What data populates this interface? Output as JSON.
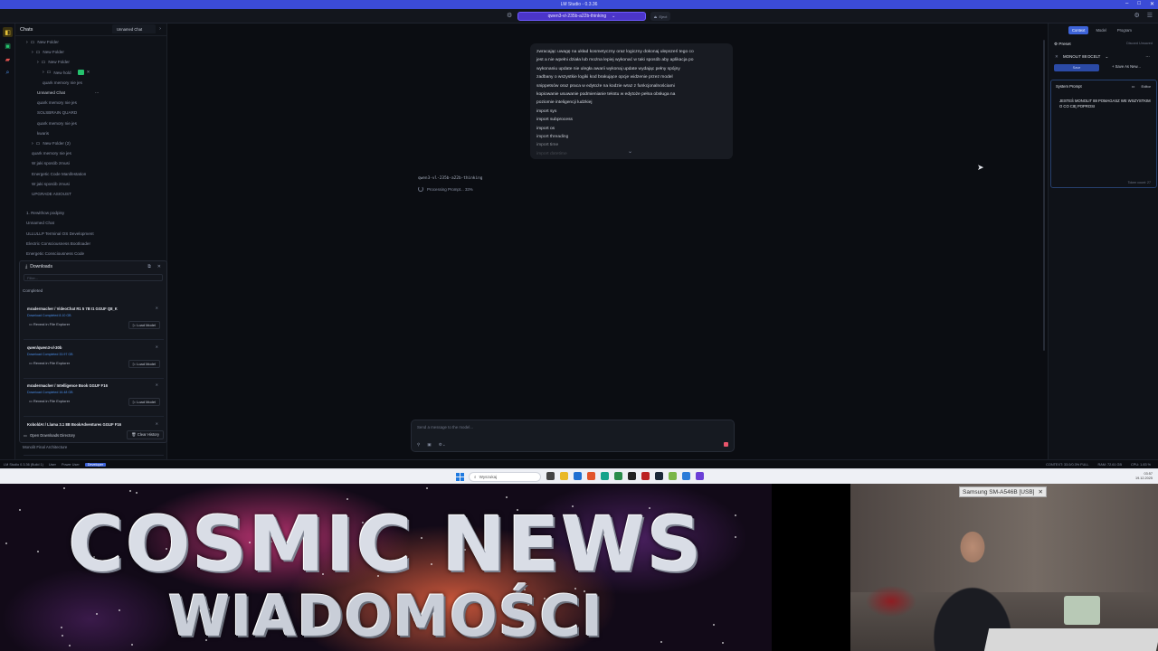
{
  "window": {
    "title": "LM Studio - 0.3.36"
  },
  "topbar": {
    "model": "qwen3-vl-235b-a22b-thinking",
    "eject": "Eject"
  },
  "sidebar": {
    "title": "Chats",
    "tree": [
      {
        "label": "New Folder",
        "indent": 1,
        "folder": true
      },
      {
        "label": "New Folder",
        "indent": 2,
        "folder": true
      },
      {
        "label": "New Folder",
        "indent": 3,
        "folder": true
      },
      {
        "label": "New hold",
        "indent": 4,
        "folder": true,
        "editing": true
      },
      {
        "label": "quark memory nie jes",
        "indent": 4
      },
      {
        "label": "Unnamed Chat",
        "indent": 3,
        "bright": true
      },
      {
        "label": "quark memory nie jes",
        "indent": 3
      },
      {
        "label": "SOLSBRAIN QUARD",
        "indent": 3
      },
      {
        "label": "quark memory nie jes",
        "indent": 3
      },
      {
        "label": "kwaris",
        "indent": 3
      },
      {
        "label": "New Folder (2)",
        "indent": 2,
        "folder": true
      },
      {
        "label": "quark memory nie jes",
        "indent": 2
      },
      {
        "label": "W jaki sposób zmusi",
        "indent": 2
      },
      {
        "label": "Energetic Code Manifestation",
        "indent": 2
      },
      {
        "label": "W jaki sposób zmusi",
        "indent": 2
      },
      {
        "label": "UPGRADE ASIOUST",
        "indent": 2
      },
      {
        "label": "1. Rewithow podpisy",
        "indent": 1,
        "gap": true
      },
      {
        "label": "Unnamed Chat",
        "indent": 1
      },
      {
        "label": "ULLULLP Terminal OS Development",
        "indent": 1
      },
      {
        "label": "Electric Consciousness Bootloader",
        "indent": 1
      },
      {
        "label": "Energetic Consciousness Code",
        "indent": 1
      }
    ],
    "bottom_item": "Monolit Final Architecture"
  },
  "downloads": {
    "title": "Downloads",
    "filter_placeholder": "Filter...",
    "section": "Completed",
    "items": [
      {
        "name": "mradermacher / VideoChat R1 5 7B I1 GGUF Q8_K",
        "status": "Download Completed  8.10 GB",
        "reveal": "Reveal in File Explorer",
        "load": "Load Model"
      },
      {
        "name": "qwen/qwen3-vl-30b",
        "status": "Download Completed  33.97 GB",
        "reveal": "Reveal in File Explorer",
        "load": "Load Model"
      },
      {
        "name": "mradermacher / Intelligence Book GGUF F16",
        "status": "Download Completed  16.48 GB",
        "reveal": "Reveal in File Explorer",
        "load": "Load Model"
      },
      {
        "name": "KoboldAI / Llama 3.1 8B BookAdventures GGUF F16",
        "status": "",
        "reveal": "",
        "load": ""
      }
    ],
    "open_dir": "Open Downloads Directory",
    "clear": "Clear History"
  },
  "chat": {
    "tab": "Unnamed Chat",
    "user_message": [
      "zwracając uwagę na układ kosmetyczny oraz logiczny dokonaj ulepszeń tego co",
      "jest a nie wpełni działa lub można lepiej wykonać w taki sposób aby aplikacja po",
      "wykonaniu update nie uległa awarii   wykonaj update wydając pełny spójny",
      "zadbany o wszystkie logiki kod brakujące opcje widzenie przez model",
      "snippetsów oraz praca w edytoże na kodzie wraz z funkcjonalnościami",
      "kopiowanie usuwanie podmienianie tekstu w edytoże pełna obsługa na",
      "poziomie inteligencji ludzkiej",
      "import sys",
      "import subprocess",
      "import os",
      "import threading",
      "import time",
      "import datetime"
    ],
    "assistant_model": "qwen3-vl-235b-a22b-thinking",
    "assistant_status": "Processing Prompt... 33%",
    "composer_placeholder": "Send a message to the model..."
  },
  "right_panel": {
    "tabs": [
      "Context",
      "Model",
      "Program"
    ],
    "preset_label": "Preset",
    "preset_right": "Discard Unsaved",
    "preset_name": "MONOLIT 88 DCELT",
    "save": "Save",
    "save_as": "Save As New...",
    "system_prompt_label": "System Prompt",
    "editor_label": "Editor",
    "system_prompt_text": "JESTEŚ MONOLIT 88 POMAGASZ WE WSZYSTKIM O CO CIĘ POPROSI",
    "tokens": "Token count: 27"
  },
  "statusbar": {
    "app": "LM Studio 0.3.36 (Build 1)",
    "modes": [
      "User",
      "Power User",
      "Developer"
    ],
    "stats": [
      "CONTEXT: 33.0/0.3% FULL",
      "RAM: 72.61 GB",
      "CPU: 1.83 %"
    ]
  },
  "taskbar": {
    "search": "Wyszukaj",
    "time": "03:57",
    "date": "19.12.2025"
  },
  "overlay": {
    "banner_line1": "COSMIC NEWS",
    "banner_line2": "WIADOMOŚCI",
    "camera_label": "Samsung SM-A546B [USB]"
  },
  "colors": {
    "accent": "#3d63d8",
    "model_pill": "#4b35c9",
    "title_bar": "#3b4bd6"
  }
}
